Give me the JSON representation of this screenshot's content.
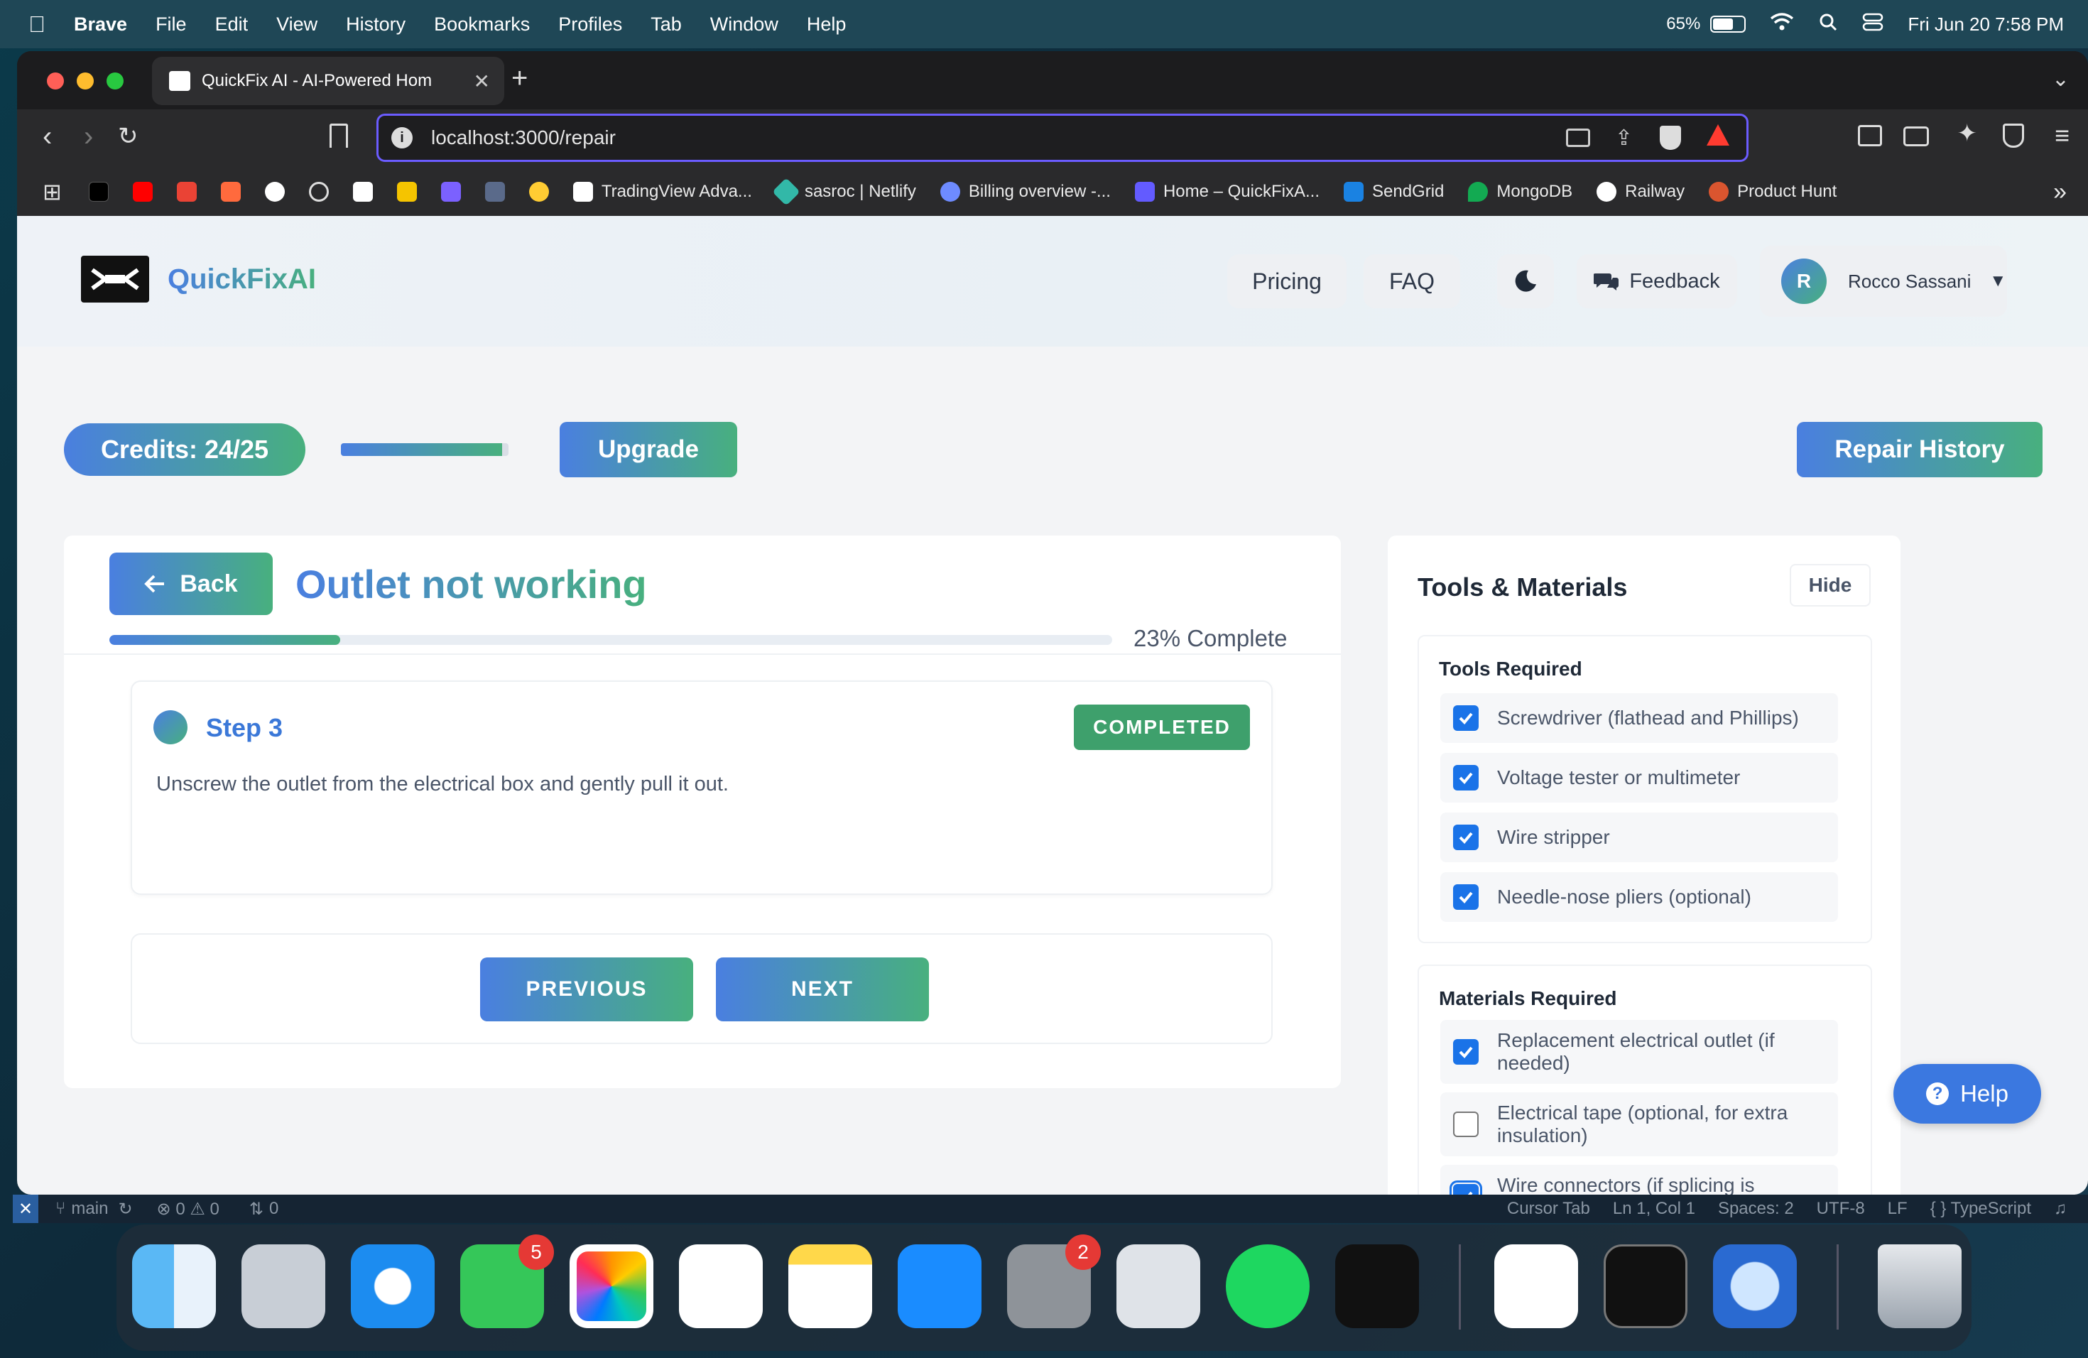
{
  "menubar": {
    "items": [
      "Brave",
      "File",
      "Edit",
      "View",
      "History",
      "Bookmarks",
      "Profiles",
      "Tab",
      "Window",
      "Help"
    ],
    "battery": "65%",
    "datetime": "Fri Jun 20  7:58 PM"
  },
  "browser": {
    "tab_title": "QuickFix AI - AI-Powered Hom",
    "url": "localhost:3000/repair",
    "bookmarks": [
      "TradingView Adva...",
      "sasroc | Netlify",
      "Billing overview -...",
      "Home – QuickFixA...",
      "SendGrid",
      "MongoDB",
      "Railway",
      "Product Hunt"
    ]
  },
  "header": {
    "brand": "QuickFixAI",
    "nav": {
      "pricing": "Pricing",
      "faq": "FAQ",
      "feedback": "Feedback"
    },
    "user": {
      "initial": "R",
      "name": "Rocco Sassani"
    }
  },
  "credits": {
    "label": "Credits: 24/25",
    "upgrade": "Upgrade",
    "history": "Repair History",
    "usage_fraction": 0.96
  },
  "repair": {
    "back": "Back",
    "title": "Outlet not working",
    "progress_text": "23% Complete",
    "progress_percent": 23,
    "step": {
      "label": "Step 3",
      "status": "COMPLETED",
      "text": "Unscrew the outlet from the electrical box and gently pull it out."
    },
    "prev": "PREVIOUS",
    "next": "NEXT"
  },
  "tools_panel": {
    "title": "Tools & Materials",
    "hide": "Hide",
    "tools_heading": "Tools Required",
    "tools": [
      {
        "label": "Screwdriver (flathead and Phillips)",
        "checked": true
      },
      {
        "label": "Voltage tester or multimeter",
        "checked": true
      },
      {
        "label": "Wire stripper",
        "checked": true
      },
      {
        "label": "Needle-nose pliers (optional)",
        "checked": true
      }
    ],
    "materials_heading": "Materials Required",
    "materials": [
      {
        "label": "Replacement electrical outlet (if needed)",
        "checked": true
      },
      {
        "label": "Electrical tape (optional, for extra insulation)",
        "checked": false
      },
      {
        "label": "Wire connectors (if splicing is necessary)",
        "checked": true
      }
    ]
  },
  "help": "Help",
  "statusbar": {
    "branch": "main",
    "problems": "⊗ 0 ⚠ 0",
    "ports": "0",
    "cursor_tab": "Cursor Tab",
    "position": "Ln 1, Col 1",
    "spaces": "Spaces: 2",
    "encoding": "UTF-8",
    "eol": "LF",
    "language": "{ } TypeScript"
  },
  "dock": {
    "messages_badge": "5",
    "settings_badge": "2"
  }
}
